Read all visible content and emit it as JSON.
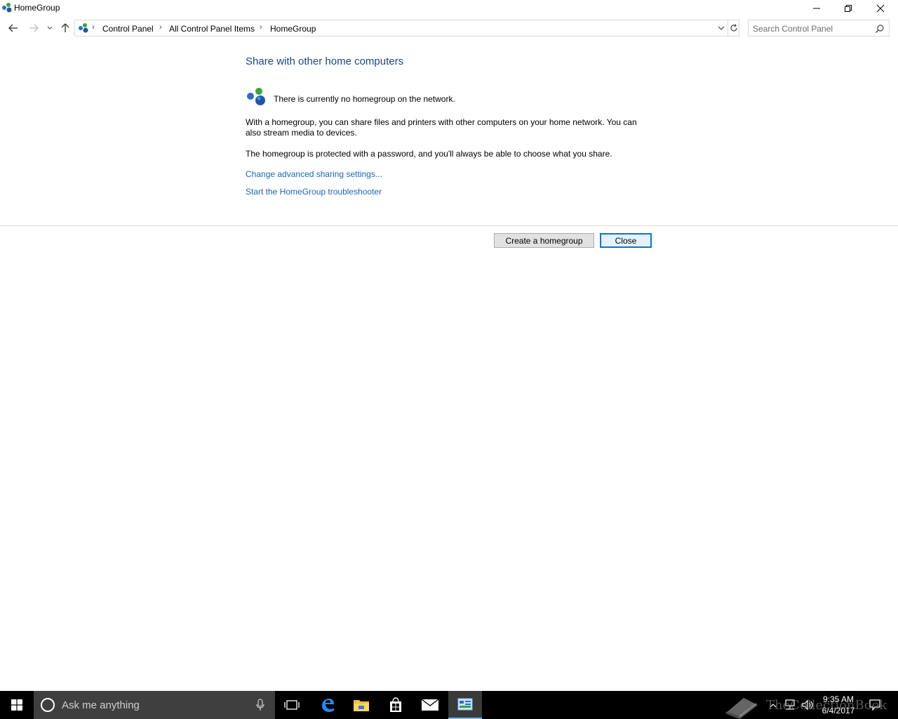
{
  "window": {
    "title": "HomeGroup",
    "icon": "homegroup-icon",
    "controls": {
      "minimize": "minimize-icon",
      "maximize": "restore-icon",
      "close": "close-icon"
    }
  },
  "address_bar": {
    "breadcrumbs": [
      "Control Panel",
      "All Control Panel Items",
      "HomeGroup"
    ],
    "search_placeholder": "Search Control Panel"
  },
  "content": {
    "heading": "Share with other home computers",
    "status": "There is currently no homegroup on the network.",
    "paragraph1": "With a homegroup, you can share files and printers with other computers on your home network. You can also stream media to devices.",
    "paragraph2": "The homegroup is protected with a password, and you'll always be able to choose what you share.",
    "link_sharing": "Change advanced sharing settings...",
    "link_troubleshooter": "Start the HomeGroup troubleshooter",
    "button_create": "Create a homegroup",
    "button_close": "Close"
  },
  "taskbar": {
    "search_placeholder": "Ask me anything",
    "time": "9:35 AM",
    "date": "6/4/2017",
    "watermark": "TheCollectionBook"
  },
  "colors": {
    "heading": "#19478a",
    "link": "#1a66b5",
    "taskbar": "#000000",
    "cortana_box": "#3f3f3f",
    "focus_border": "#0078d7"
  }
}
